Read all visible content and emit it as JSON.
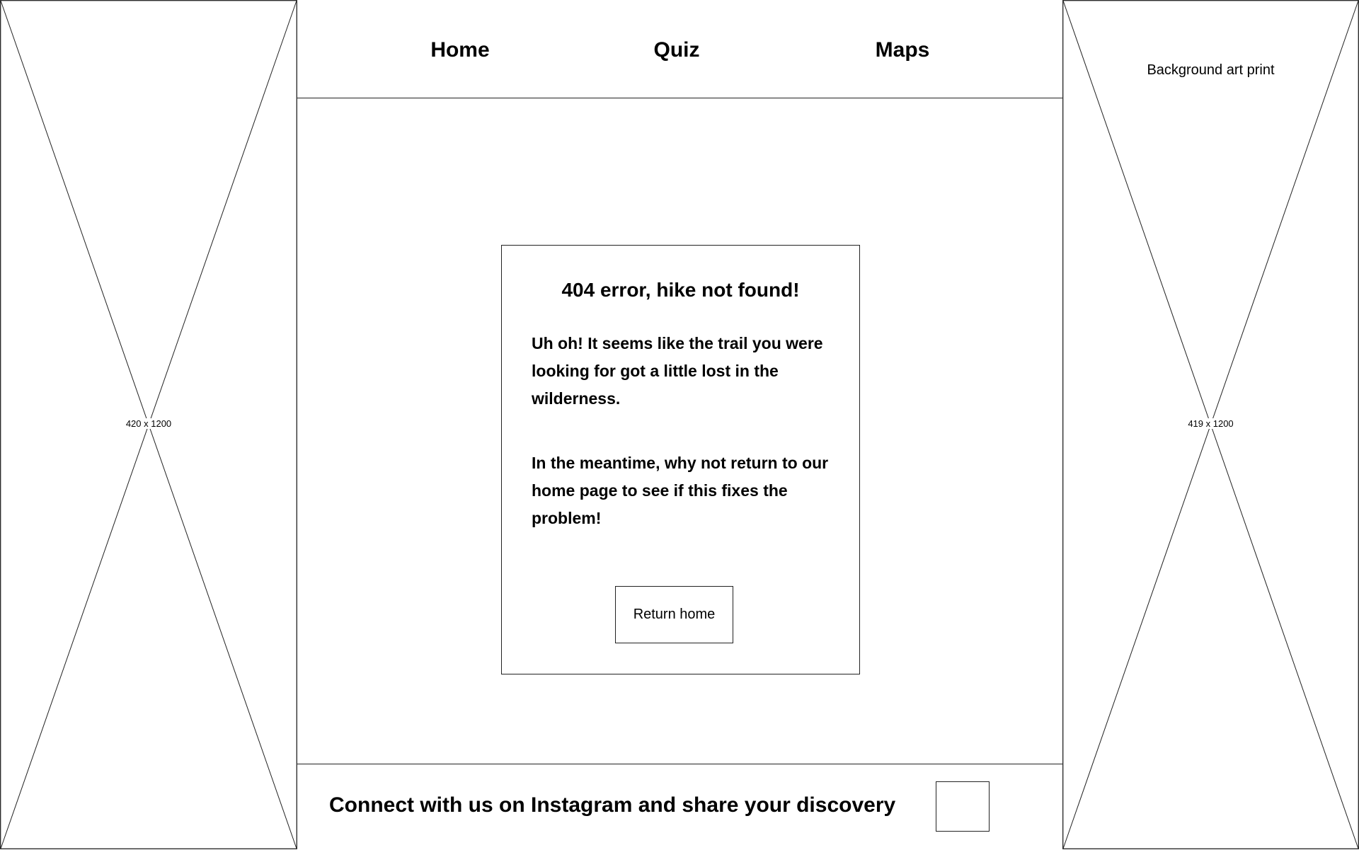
{
  "left_placeholder": {
    "dimensions": "420 x 1200"
  },
  "right_placeholder": {
    "dimensions": "419 x 1200",
    "label": "Background art print"
  },
  "nav": {
    "items": [
      {
        "label": "Home"
      },
      {
        "label": "Quiz"
      },
      {
        "label": "Maps"
      }
    ]
  },
  "error_card": {
    "title": "404 error, hike not found!",
    "paragraph_1": "Uh oh! It seems like the trail you were looking for got a little lost in the wilderness.",
    "paragraph_2": "In the meantime, why not return to our home page to see if this fixes the problem!",
    "button_label": "Return home"
  },
  "footer": {
    "text": "Connect with us on Instagram and share your discovery"
  }
}
